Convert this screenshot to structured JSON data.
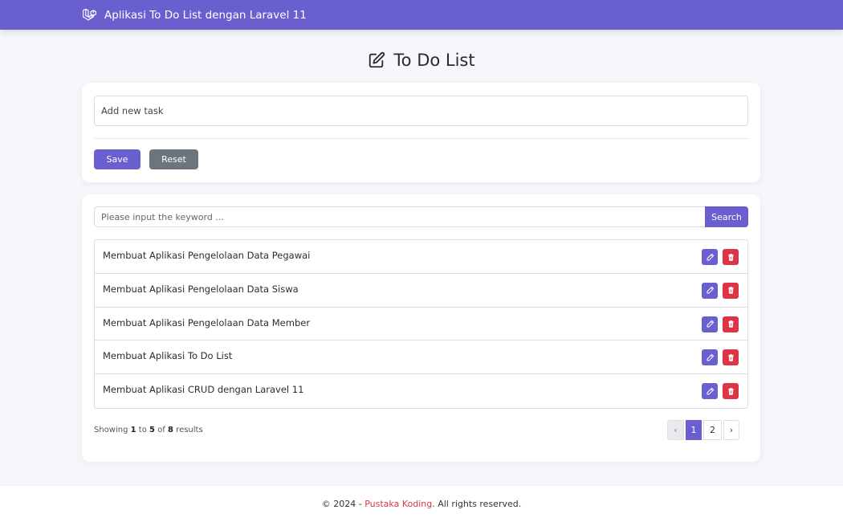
{
  "navbar": {
    "brand_icon": "laravel-logo-icon",
    "title": "Aplikasi To Do List dengan Laravel 11",
    "color": "#6a5fcf"
  },
  "heading": {
    "icon": "edit-icon",
    "title": "To Do List"
  },
  "form": {
    "task_placeholder": "Add new task",
    "task_value": "",
    "save_label": "Save",
    "reset_label": "Reset"
  },
  "search": {
    "placeholder": "Please input the keyword ...",
    "value": "",
    "button_label": "Search"
  },
  "tasks": [
    {
      "label": "Membuat Aplikasi Pengelolaan Data Pegawai"
    },
    {
      "label": "Membuat Aplikasi Pengelolaan Data Siswa"
    },
    {
      "label": "Membuat Aplikasi Pengelolaan Data Member"
    },
    {
      "label": "Membuat Aplikasi To Do List"
    },
    {
      "label": "Membuat Aplikasi CRUD dengan Laravel 11"
    }
  ],
  "pagination": {
    "showing_prefix": "Showing",
    "from": "1",
    "to_word": "to",
    "to": "5",
    "of_word": "of",
    "total": "8",
    "results_word": "results",
    "prev": "‹",
    "pages": [
      "1",
      "2"
    ],
    "active_page": "1",
    "next": "›"
  },
  "footer": {
    "prefix": "© 2024 - ",
    "link": "Pustaka Koding",
    "suffix": ". All rights reserved."
  },
  "colors": {
    "primary": "#6a5fcf",
    "danger": "#dc3545",
    "secondary": "#6c757d"
  }
}
